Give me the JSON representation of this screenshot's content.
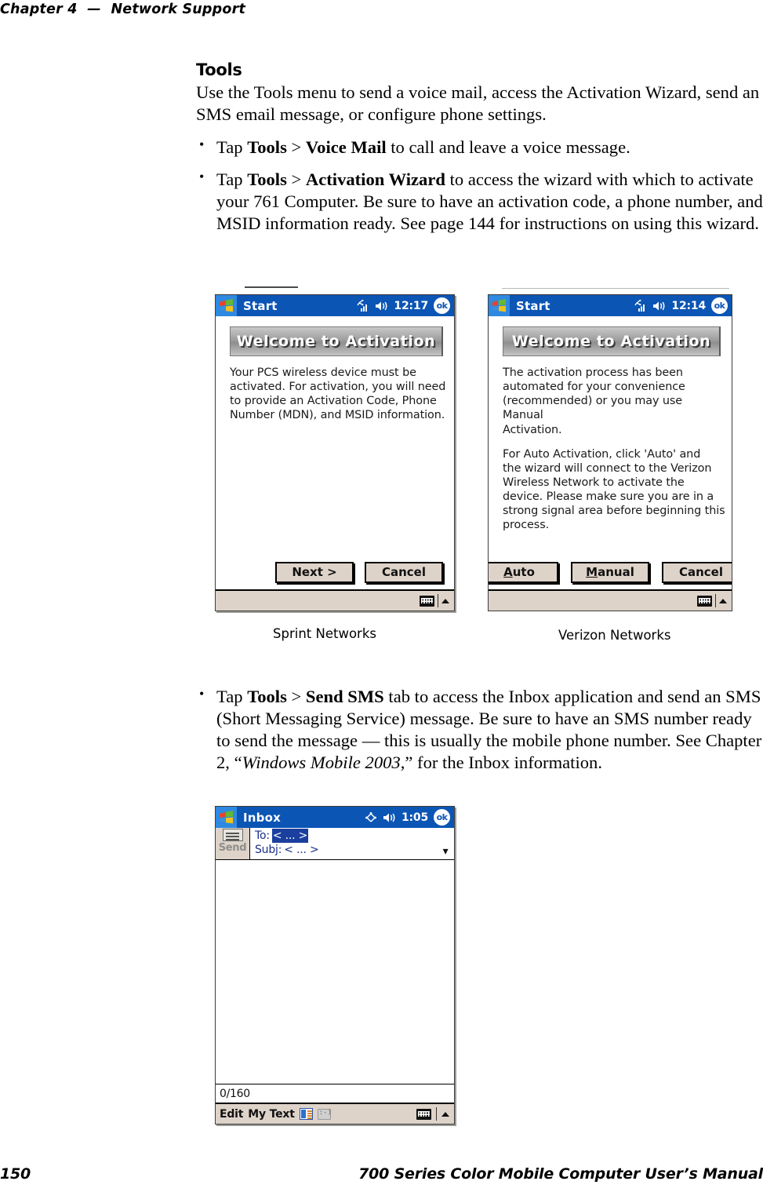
{
  "page": {
    "running_head": "Chapter 4  —  Network Support",
    "footer_page_number": "150",
    "footer_title": "700 Series Color Mobile Computer User’s Manual"
  },
  "section": {
    "title": "Tools",
    "intro": "Use the Tools menu to send a voice mail, access the Activation Wizard, send an SMS email message, or configure phone settings.",
    "bullets": [
      {
        "lead": "Tap ",
        "bold1": "Tools",
        "sep": " > ",
        "bold2": "Voice Mail",
        "rest": " to call and leave a voice message."
      },
      {
        "lead": "Tap ",
        "bold1": "Tools",
        "sep": " > ",
        "bold2": "Activation Wizard",
        "rest": " to access the wizard with which to activate your 761 Computer. Be sure to have an activation code, a phone number, and MSID information ready. See page 144 for instructions on using this wizard."
      }
    ],
    "bullet_sms": {
      "lead": "Tap ",
      "bold1": "Tools",
      "sep": " > ",
      "bold2": "Send SMS",
      "mid": " tab to access the Inbox application and send an SMS (Short Messaging Service) message. Be sure to have an SMS number ready to send the message — this is usually the mobile phone number. See Chapter 2, “",
      "italic": "Windows Mobile 2003",
      "tail": ",” for the Inbox information."
    }
  },
  "figures": {
    "sprint": {
      "caption": "Sprint Networks",
      "titlebar": {
        "start_label": "Start",
        "time": "12:17",
        "ok_label": "ok",
        "signal_icon": "signal-bars-icon",
        "volume_icon": "speaker-icon",
        "logo_icon": "windows-flag-icon"
      },
      "banner": "Welcome to Activation",
      "paragraphs": [
        "Your PCS wireless device must be\nactivated. For activation, you will need\nto provide an Activation Code, Phone\nNumber (MDN), and MSID information."
      ],
      "buttons": [
        {
          "label": "Next >",
          "accel": ""
        },
        {
          "label": "Cancel",
          "accel": ""
        }
      ],
      "sip": {
        "keyboard_icon": "keyboard-icon",
        "arrow_icon": "triangle-up-icon"
      }
    },
    "verizon": {
      "caption": "Verizon Networks",
      "titlebar": {
        "start_label": "Start",
        "time": "12:14",
        "ok_label": "ok",
        "signal_icon": "signal-bars-icon",
        "volume_icon": "speaker-icon",
        "logo_icon": "windows-flag-icon"
      },
      "banner": "Welcome to Activation",
      "paragraphs": [
        "The activation process has been\nautomated for your convenience\n(recommended) or you may use Manual\nActivation.",
        "For Auto Activation, click 'Auto' and\nthe wizard will connect to the Verizon\nWireless Network to activate the\ndevice.  Please make sure you are in a\nstrong signal area before beginning this\nprocess."
      ],
      "buttons": [
        {
          "accel": "A",
          "label": "uto"
        },
        {
          "accel": "M",
          "label": "anual"
        },
        {
          "accel": "",
          "label": "Cancel"
        }
      ],
      "sip": {
        "keyboard_icon": "keyboard-icon",
        "arrow_icon": "triangle-up-icon"
      }
    },
    "inbox": {
      "titlebar": {
        "start_label": "Inbox",
        "time": "1:05",
        "ok_label": "ok",
        "signal_icon": "connectivity-icon",
        "volume_icon": "speaker-icon",
        "logo_icon": "windows-flag-icon"
      },
      "send_button": {
        "label": "Send",
        "icon": "envelope-icon"
      },
      "fields": {
        "to_label": "To:",
        "to_value": "< ... >",
        "subj_label": "Subj:",
        "subj_value": "< ... >",
        "expand_icon": "chevron-double-down-icon"
      },
      "body_text": "",
      "counter": "0/160",
      "menubar": {
        "edit_label": "Edit",
        "mytext_label": "My Text",
        "icon_a": "mytext-list-icon",
        "icon_b": "emoticon-icon",
        "keyboard_icon": "keyboard-icon",
        "arrow_icon": "triangle-up-icon"
      }
    }
  },
  "colors": {
    "titlebar_blue": "#0b55b5",
    "start_blue": "#2f89e0",
    "sip_tan": "#ded3c9",
    "highlight_blue": "#1b3f9e",
    "field_text_blue": "#1b2f8a"
  }
}
